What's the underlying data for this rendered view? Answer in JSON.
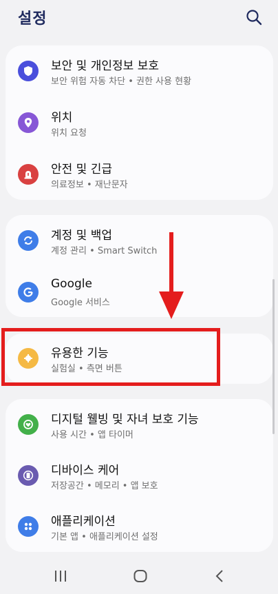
{
  "header": {
    "title": "설정"
  },
  "groups": [
    {
      "items": [
        {
          "label": "보안 및 개인정보 보호",
          "sub": "보안 위험 자동 차단 • 권한 사용 현황",
          "icon": "shield-icon",
          "color": "#4a4fdc"
        },
        {
          "label": "위치",
          "sub": "위치 요청",
          "icon": "location-pin-icon",
          "color": "#8757d6"
        },
        {
          "label": "안전 및 긴급",
          "sub": "의료정보 • 재난문자",
          "icon": "emergency-siren-icon",
          "color": "#d94141"
        }
      ]
    },
    {
      "items": [
        {
          "label": "계정 및 백업",
          "sub": "계정 관리 • Smart Switch",
          "icon": "sync-icon",
          "color": "#3f7de8"
        },
        {
          "label": "Google",
          "sub": "Google 서비스",
          "icon": "google-icon",
          "color": "#3f7de8"
        }
      ]
    },
    {
      "items": [
        {
          "label": "유용한 기능",
          "sub": "실험실 • 측면 버튼",
          "icon": "puzzle-gear-icon",
          "color": "#f5b944"
        }
      ]
    },
    {
      "items": [
        {
          "label": "디지털 웰빙 및 자녀 보호 기능",
          "sub": "사용 시간 • 앱 타이머",
          "icon": "wellbeing-heart-icon",
          "color": "#43b04a"
        },
        {
          "label": "디바이스 케어",
          "sub": "저장공간 • 메모리 • 앱 보호",
          "icon": "device-care-icon",
          "color": "#6a5bb0"
        },
        {
          "label": "애플리케이션",
          "sub": "기본 앱 • 애플리케이션 설정",
          "icon": "apps-grid-icon",
          "color": "#3f7de8"
        }
      ]
    }
  ],
  "annotation": {
    "highlight_color": "#e41d1d"
  },
  "navbar": {
    "recent": "recent-apps-icon",
    "home": "home-icon",
    "back": "back-icon"
  }
}
